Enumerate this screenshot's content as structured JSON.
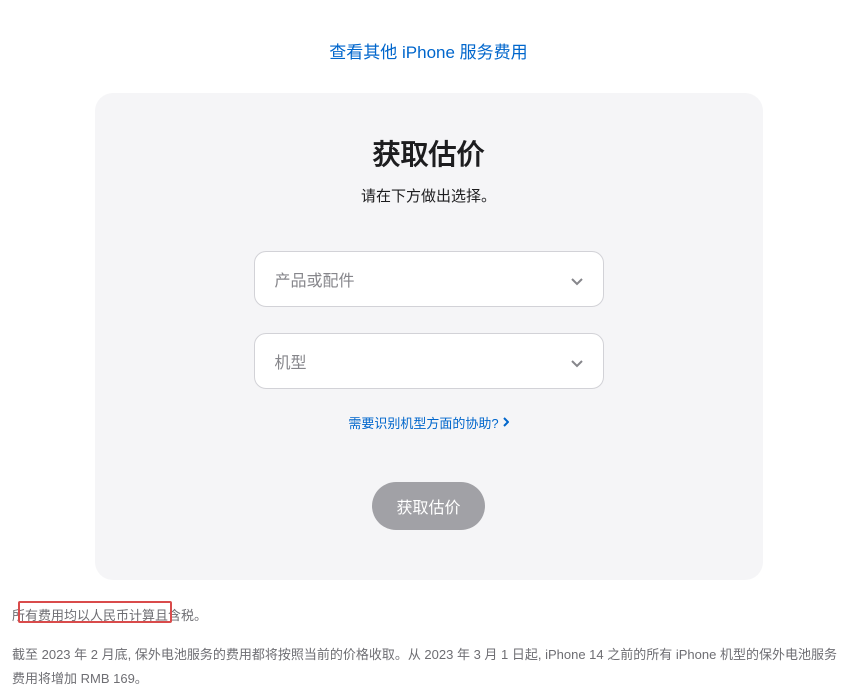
{
  "top_link": {
    "label": "查看其他 iPhone 服务费用"
  },
  "card": {
    "title": "获取估价",
    "subtitle": "请在下方做出选择。",
    "select_product": {
      "placeholder": "产品或配件"
    },
    "select_model": {
      "placeholder": "机型"
    },
    "help_link": {
      "label": "需要识别机型方面的协助?"
    },
    "submit": {
      "label": "获取估价"
    }
  },
  "footer": {
    "note1": "所有费用均以人民币计算且含税。",
    "note2_part1": "截至 2023 年 2 月底, 保外电池服务的费用都将按照当前的价格收取。从 2023 年 3 月 1 日起, iPhone 14 之前的所有 iPhone 机型的保外电池服务",
    "note2_part2": "费用将增加 RMB 169。"
  }
}
